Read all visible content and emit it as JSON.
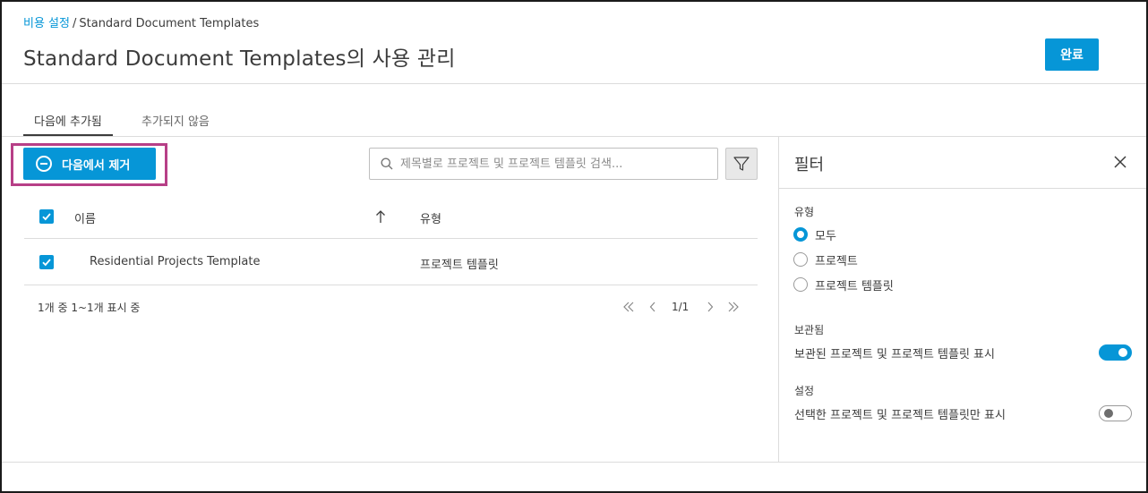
{
  "breadcrumb": {
    "link": "비용 설정",
    "separator": "/",
    "current": "Standard Document Templates"
  },
  "page_title": "Standard Document Templates의 사용 관리",
  "done_label": "완료",
  "tabs": [
    {
      "label": "다음에 추가됨",
      "active": true
    },
    {
      "label": "추가되지 않음",
      "active": false
    }
  ],
  "toolbar": {
    "remove_label": "다음에서 제거",
    "search_placeholder": "제목별로 프로젝트 및 프로젝트 템플릿 검색..."
  },
  "table": {
    "columns": {
      "name": "이름",
      "type": "유형"
    },
    "header_checked": true,
    "rows": [
      {
        "checked": true,
        "name": "Residential Projects Template",
        "type": "프로젝트 템플릿"
      }
    ],
    "count_text": "1개 중 1~1개 표시 중",
    "page_text": "1/1"
  },
  "filter_panel": {
    "title": "필터",
    "type_label": "유형",
    "type_options": [
      {
        "label": "모두",
        "checked": true
      },
      {
        "label": "프로젝트",
        "checked": false
      },
      {
        "label": "프로젝트 템플릿",
        "checked": false
      }
    ],
    "archived_label": "보관됨",
    "archived_toggle_label": "보관된 프로젝트 및 프로젝트 템플릿 표시",
    "archived_toggle_on": true,
    "settings_label": "설정",
    "selected_toggle_label": "선택한 프로젝트 및 프로젝트 템플릿만 표시",
    "selected_toggle_on": false
  },
  "colors": {
    "accent": "#0696d7",
    "highlight": "#b73f87"
  }
}
